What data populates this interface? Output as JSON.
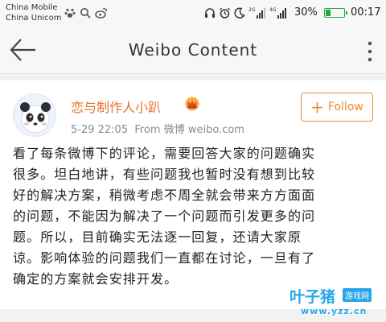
{
  "status_bar": {
    "carrier_1": "China Mobile",
    "carrier_2": "China Unicom",
    "network_1": "2G",
    "network_2": "4G",
    "battery_percent_text": "30%",
    "battery_level": 0.3,
    "time": "00:17",
    "battery_color": "#1faa3c"
  },
  "title_bar": {
    "title": "Weibo Content",
    "back_icon": "arrow-left-icon",
    "more_icon": "more-vertical-icon"
  },
  "post": {
    "user_name": "恋与制作人小趴",
    "meta": "5-29 22:05  From 微博 weibo.com",
    "follow_label": "Follow",
    "accent_color": "#f08a2e",
    "content_lines": [
      "看了每条微博下的评论，需要回答大家的问题确实",
      "很多。坦白地讲，有些问题我也暂时没有想到比较",
      "好的解决方案，稍微考虑不周全就会带来方方面面",
      "的问题，不能因为解决了一个问题而引发更多的问",
      "题。所以，目前确实无法逐一回复，还请大家原",
      "谅。影响体验的问题我们一直都在讨论，一旦有了",
      "确定的方案就会安排开发。"
    ]
  },
  "watermark": {
    "name": "叶子猪",
    "tag": "游戏网",
    "url": "www.yzz.cn"
  }
}
